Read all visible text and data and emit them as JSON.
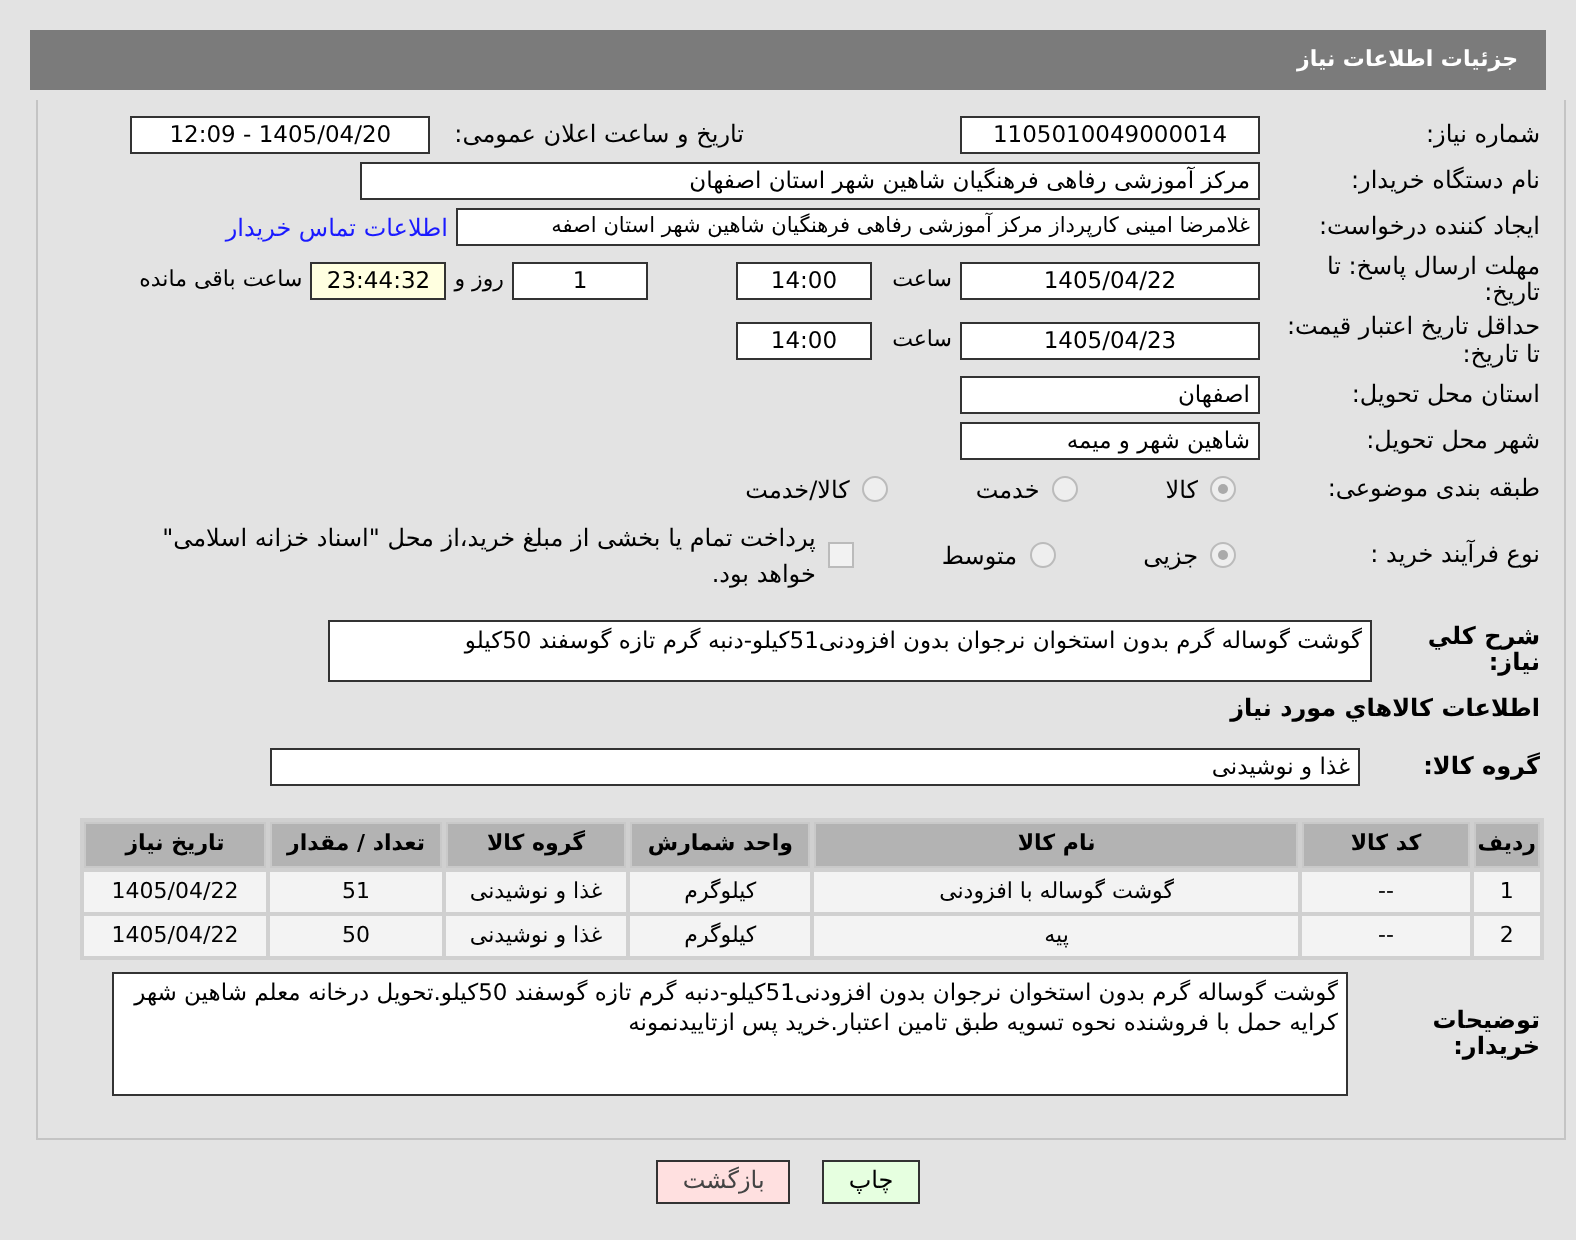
{
  "header": {
    "title": "جزئیات اطلاعات نیاز"
  },
  "need_number": {
    "label": "شماره نیاز:",
    "value": "1105010049000014"
  },
  "announce": {
    "label": "تاریخ و ساعت اعلان عمومی:",
    "value": "1405/04/20 - 12:09"
  },
  "buyer_org": {
    "label": "نام دستگاه خریدار:",
    "value": "مرکز آموزشی رفاهی فرهنگیان شاهین شهر استان اصفهان"
  },
  "requester": {
    "label": "ایجاد کننده درخواست:",
    "value": "غلامرضا امینی کارپرداز مرکز آموزشی رفاهی فرهنگیان شاهین شهر استان اصفه",
    "link": "اطلاعات تماس خریدار"
  },
  "reply_deadline": {
    "label": "مهلت ارسال پاسخ: تا تاریخ:",
    "date": "1405/04/22",
    "time_label": "ساعت",
    "time": "14:00",
    "days": "1",
    "days_label": "روز و",
    "remaining": "23:44:32",
    "remaining_label": "ساعت باقی مانده"
  },
  "price_validity": {
    "label": "حداقل تاریخ اعتبار قیمت: تا تاریخ:",
    "date": "1405/04/23",
    "time_label": "ساعت",
    "time": "14:00"
  },
  "province": {
    "label": "استان محل تحویل:",
    "value": "اصفهان"
  },
  "city": {
    "label": "شهر محل تحویل:",
    "value": "شاهین شهر و میمه"
  },
  "category": {
    "label": "طبقه بندی موضوعی:",
    "options": [
      {
        "label": "کالا",
        "selected": true
      },
      {
        "label": "خدمت",
        "selected": false
      },
      {
        "label": "کالا/خدمت",
        "selected": false
      }
    ]
  },
  "process_type": {
    "label": "نوع فرآیند خرید :",
    "options": [
      {
        "label": "جزیی",
        "selected": true
      },
      {
        "label": "متوسط",
        "selected": false
      }
    ],
    "payment_note": {
      "label": "پرداخت تمام یا بخشی از مبلغ خرید،از محل \"اسناد خزانه اسلامی\" خواهد بود.",
      "checked": false
    }
  },
  "description": {
    "label": "شرح کلي نياز:",
    "value": "گوشت گوساله گرم بدون استخوان نرجوان بدون افزودنی51کیلو-دنبه گرم تازه گوسفند 50کیلو"
  },
  "goods_heading": "اطلاعات کالاهاي مورد نياز",
  "goods_group": {
    "label": "گروه کالا:",
    "value": "غذا و نوشیدنی"
  },
  "table": {
    "columns": [
      "ردیف",
      "کد کالا",
      "نام کالا",
      "واحد شمارش",
      "گروه کالا",
      "تعداد / مقدار",
      "تاریخ نیاز"
    ],
    "rows": [
      [
        "1",
        "--",
        "گوشت گوساله با افزودنی",
        "کیلوگرم",
        "غذا و نوشیدنی",
        "51",
        "1405/04/22"
      ],
      [
        "2",
        "--",
        "پیه",
        "کیلوگرم",
        "غذا و نوشیدنی",
        "50",
        "1405/04/22"
      ]
    ]
  },
  "buyer_notes": {
    "label": "توضیحات خریدار:",
    "value": "گوشت گوساله گرم بدون استخوان نرجوان بدون افزودنی51کیلو-دنبه گرم تازه گوسفند 50کیلو.تحویل درخانه معلم شاهین شهر کرایه حمل با فروشنده نحوه تسویه طبق تامین اعتبار.خرید پس ازتاییدنمونه"
  },
  "buttons": [
    {
      "label": "چاپ",
      "kind": "print"
    },
    {
      "label": "بازگشت",
      "kind": "back"
    }
  ]
}
